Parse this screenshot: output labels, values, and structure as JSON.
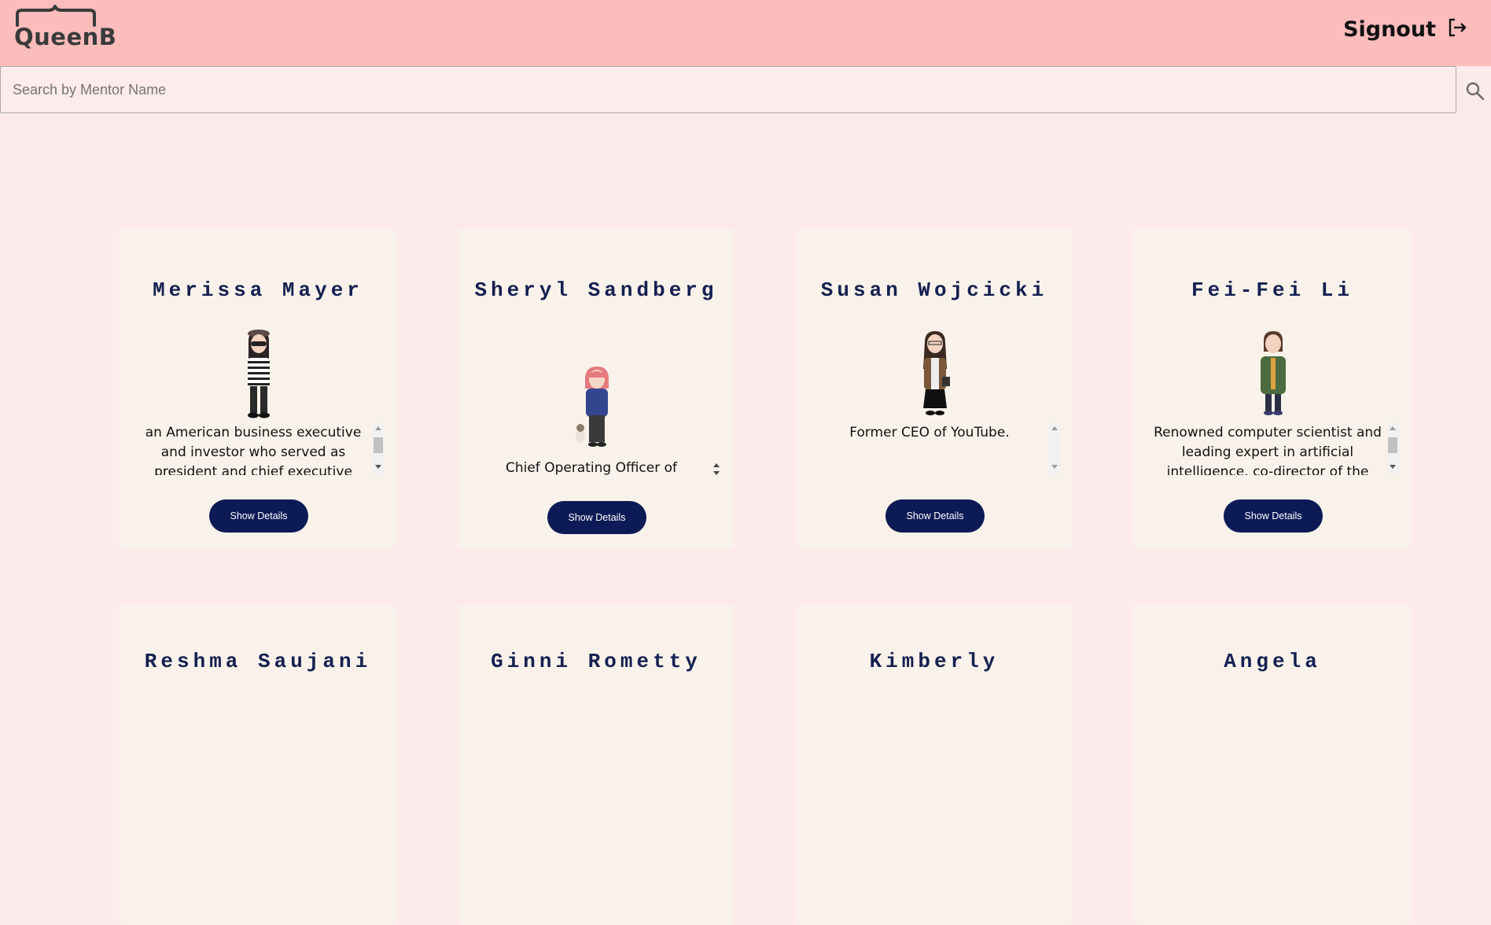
{
  "app": {
    "logo_text": "QueenB",
    "signout_label": "Signout"
  },
  "search": {
    "placeholder": "Search by Mentor Name",
    "value": ""
  },
  "mentors": [
    {
      "name": "Merissa Mayer",
      "description": "an American business executive and investor who served as president and chief executive",
      "button_label": "Show Details"
    },
    {
      "name": "Sheryl Sandberg",
      "description": "Chief Operating Officer of",
      "button_label": "Show Details"
    },
    {
      "name": "Susan Wojcicki",
      "description": "Former CEO of YouTube.",
      "button_label": "Show Details"
    },
    {
      "name": "Fei-Fei Li",
      "description": "Renowned computer scientist and leading expert in artificial intelligence, co-director of the",
      "button_label": "Show Details"
    },
    {
      "name": "Reshma Saujani"
    },
    {
      "name": "Ginni Rometty"
    },
    {
      "name": "Kimberly"
    },
    {
      "name": "Angela"
    }
  ],
  "colors": {
    "header_bg": "#fbbcbc",
    "page_bg": "#fdeaea",
    "card_bg": "#f8f2ea",
    "name_color": "#152051",
    "button_bg": "#0c1a56"
  },
  "icons": [
    "logo-brace-icon",
    "signout-icon",
    "search-icon",
    "avatar-mentor"
  ]
}
